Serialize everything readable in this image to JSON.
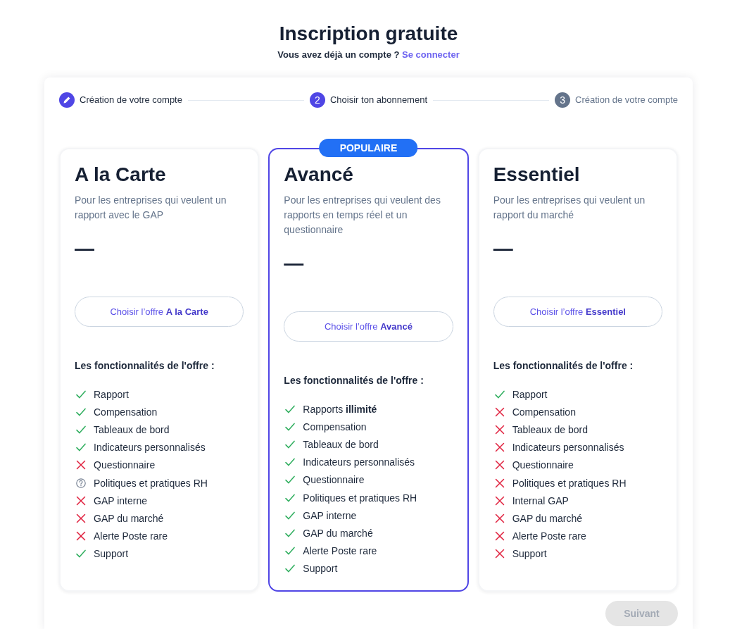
{
  "header": {
    "title": "Inscription gratuite",
    "prompt": "Vous avez déjà un compte ?",
    "link": "Se connecter"
  },
  "steps": [
    {
      "kind": "completed",
      "label": "Création de votre compte"
    },
    {
      "kind": "current",
      "number": "2",
      "label": "Choisir ton abonnement"
    },
    {
      "kind": "upcoming",
      "number": "3",
      "label": "Création de votre compte"
    }
  ],
  "plans": [
    {
      "name": "A la Carte",
      "highlighted": false,
      "description": "Pour les entreprises qui veulent un rapport avec le GAP",
      "price": "—",
      "button": "Choisir l’offre **A la Carte**",
      "features_title": "Les fonctionnalités de l'offre :",
      "features": [
        {
          "kind": "included",
          "label": "Rapport"
        },
        {
          "kind": "included",
          "label": "Compensation"
        },
        {
          "kind": "included",
          "label": "Tableaux de bord"
        },
        {
          "kind": "included",
          "label": "Indicateurs personnalisés"
        },
        {
          "kind": "excluded",
          "label": "Questionnaire"
        },
        {
          "kind": "unknown",
          "label": "Politiques et pratiques RH"
        },
        {
          "kind": "excluded",
          "label": "GAP interne"
        },
        {
          "kind": "excluded",
          "label": "GAP du marché"
        },
        {
          "kind": "excluded",
          "label": "Alerte Poste rare"
        },
        {
          "kind": "included",
          "label": "Support"
        }
      ]
    },
    {
      "name": "Avancé",
      "highlighted": true,
      "badge": "POPULAIRE",
      "description": "Pour les entreprises qui veulent des rapports en temps réel et un questionnaire",
      "price": "—",
      "button": "Choisir l’offre **Avancé**",
      "features_title": "Les fonctionnalités de l'offre :",
      "features": [
        {
          "kind": "included",
          "label": "Rapports **illimité**"
        },
        {
          "kind": "included",
          "label": "Compensation"
        },
        {
          "kind": "included",
          "label": "Tableaux de bord"
        },
        {
          "kind": "included",
          "label": "Indicateurs personnalisés"
        },
        {
          "kind": "included",
          "label": "Questionnaire"
        },
        {
          "kind": "included",
          "label": "Politiques et pratiques RH"
        },
        {
          "kind": "included",
          "label": "GAP interne"
        },
        {
          "kind": "included",
          "label": "GAP du marché"
        },
        {
          "kind": "included",
          "label": "Alerte Poste rare"
        },
        {
          "kind": "included",
          "label": "Support"
        }
      ]
    },
    {
      "name": "Essentiel",
      "highlighted": false,
      "description": "Pour les entreprises qui veulent un rapport du marché",
      "price": "—",
      "button": "Choisir l’offre **Essentiel**",
      "features_title": "Les fonctionnalités de l'offre :",
      "features": [
        {
          "kind": "included",
          "label": "Rapport"
        },
        {
          "kind": "excluded",
          "label": "Compensation"
        },
        {
          "kind": "excluded",
          "label": "Tableaux de bord"
        },
        {
          "kind": "excluded",
          "label": "Indicateurs personnalisés"
        },
        {
          "kind": "excluded",
          "label": "Questionnaire"
        },
        {
          "kind": "excluded",
          "label": "Politiques et pratiques RH"
        },
        {
          "kind": "excluded",
          "label": "Internal GAP"
        },
        {
          "kind": "excluded",
          "label": "GAP du marché"
        },
        {
          "kind": "excluded",
          "label": "Alerte Poste rare"
        },
        {
          "kind": "excluded",
          "label": "Support"
        }
      ]
    }
  ],
  "next_button": {
    "label": "Suivant",
    "disabled": true
  }
}
